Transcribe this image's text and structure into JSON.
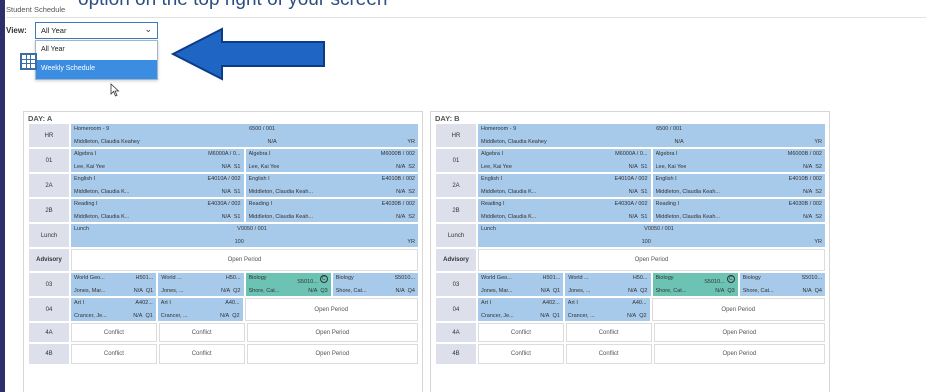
{
  "caption": "option on the top right of your screen",
  "app_title": "Student Schedule",
  "view": {
    "label": "View:",
    "selected": "All Year",
    "options": [
      "All Year",
      "Weekly Schedule"
    ],
    "highlighted_option": "Weekly Schedule"
  },
  "colors": {
    "accent": "#2c2f6b",
    "course_blue": "#a7c9ea",
    "course_green": "#6cc3b3",
    "arrow": "#1f66c4",
    "dropdown_highlight": "#3b8de2"
  },
  "icons": [
    "calendar-grid-icon",
    "cursor-pointer-icon",
    "left-arrow-icon",
    "chevron-down-icon"
  ],
  "days": [
    {
      "title": "DAY: A",
      "rows": [
        {
          "period": "HR",
          "cells": [
            {
              "l1": "Homeroom - 9",
              "l1r": "",
              "l1b": "6500 / 001",
              "l2": "Middleton, Claudia Keahey",
              "l2r": "",
              "l2b": "N/A",
              "tag": "YR"
            }
          ]
        },
        {
          "period": "01",
          "cells": [
            {
              "l1": "Algebra I",
              "l1r": "M6000A / 0...",
              "l2": "Lee, Kai Yee",
              "l2r": "N/A",
              "tag": "S1"
            },
            {
              "l1": "Algebra I",
              "l1r": "M6000B / 002",
              "l2": "Lee, Kai Yee",
              "l2r": "N/A",
              "tag": "S2"
            }
          ]
        },
        {
          "period": "2A",
          "cells": [
            {
              "l1": "English I",
              "l1r": "E4010A / 002",
              "l2": "Middleton, Claudia K...",
              "l2r": "N/A",
              "tag": "S1"
            },
            {
              "l1": "English I",
              "l1r": "E4010B / 002",
              "l2": "Middleton, Claudia Keah...",
              "l2r": "N/A",
              "tag": "S2"
            }
          ]
        },
        {
          "period": "2B",
          "cells": [
            {
              "l1": "Reading I",
              "l1r": "E4030A / 002",
              "l2": "Middleton, Claudia K...",
              "l2r": "N/A",
              "tag": "S1"
            },
            {
              "l1": "Reading I",
              "l1r": "E4030B / 002",
              "l2": "Middleton, Claudia Keah...",
              "l2r": "N/A",
              "tag": "S2"
            }
          ]
        },
        {
          "period": "Lunch",
          "cells": [
            {
              "l1": "Lunch",
              "l1b": "V0050 / 001",
              "l2": "",
              "l2b": "100",
              "tag": "YR"
            }
          ]
        },
        {
          "period": "Advisory",
          "cells": [
            {
              "text": "Open Period"
            }
          ]
        },
        {
          "period": "03",
          "cells": [
            {
              "l1": "World Geo...",
              "l1r": "H501...",
              "l2": "Jones, Mar...",
              "l2r": "N/A",
              "tag": "Q1"
            },
            {
              "l1": "World ...",
              "l1r": "H50...",
              "l2": "Jones, ...",
              "l2r": "N/A",
              "tag": "Q2"
            },
            {
              "l1": "Biology",
              "l1r": "S5010...",
              "l2": "Shore, Cat...",
              "l2r": "N/A",
              "tag": "Q3",
              "green": true,
              "badge": "C"
            },
            {
              "l1": "Biology",
              "l1r": "S5010...",
              "l2": "Shore, Cat...",
              "l2r": "N/A",
              "tag": "Q4"
            }
          ]
        },
        {
          "period": "04",
          "cells": [
            {
              "l1": "Art I",
              "l1r": "A402...",
              "l2": "Crancer, Je...",
              "l2r": "N/A",
              "tag": "Q1"
            },
            {
              "l1": "Art I",
              "l1r": "A40...",
              "l2": "Crancer, ...",
              "l2r": "N/A",
              "tag": "Q2"
            },
            {
              "text": "Open Period"
            }
          ]
        },
        {
          "period": "4A",
          "cells": [
            {
              "text": "Conflict"
            },
            {
              "text": "Conflict"
            },
            {
              "text": "Open Period"
            }
          ]
        },
        {
          "period": "4B",
          "cells": [
            {
              "text": "Conflict"
            },
            {
              "text": "Conflict"
            },
            {
              "text": "Open Period"
            }
          ]
        }
      ]
    },
    {
      "title": "DAY: B",
      "rows": [
        {
          "period": "HR",
          "cells": [
            {
              "l1": "Homeroom - 9",
              "l1r": "",
              "l1b": "6500 / 001",
              "l2": "Middleton, Claudia Keahey",
              "l2r": "",
              "l2b": "N/A",
              "tag": "YR"
            }
          ]
        },
        {
          "period": "01",
          "cells": [
            {
              "l1": "Algebra I",
              "l1r": "M6000A / 0...",
              "l2": "Lee, Kai Yee",
              "l2r": "N/A",
              "tag": "S1"
            },
            {
              "l1": "Algebra I",
              "l1r": "M6000B / 002",
              "l2": "Lee, Kai Yee",
              "l2r": "N/A",
              "tag": "S2"
            }
          ]
        },
        {
          "period": "2A",
          "cells": [
            {
              "l1": "English I",
              "l1r": "E4010A / 002",
              "l2": "Middleton, Claudia K...",
              "l2r": "N/A",
              "tag": "S1"
            },
            {
              "l1": "English I",
              "l1r": "E4010B / 002",
              "l2": "Middleton, Claudia Keah...",
              "l2r": "N/A",
              "tag": "S2"
            }
          ]
        },
        {
          "period": "2B",
          "cells": [
            {
              "l1": "Reading I",
              "l1r": "E4030A / 002",
              "l2": "Middleton, Claudia K...",
              "l2r": "N/A",
              "tag": "S1"
            },
            {
              "l1": "Reading I",
              "l1r": "E4030B / 002",
              "l2": "Middleton, Claudia Keah...",
              "l2r": "N/A",
              "tag": "S2"
            }
          ]
        },
        {
          "period": "Lunch",
          "cells": [
            {
              "l1": "Lunch",
              "l1b": "V0050 / 001",
              "l2": "",
              "l2b": "100",
              "tag": "YR"
            }
          ]
        },
        {
          "period": "Advisory",
          "cells": [
            {
              "text": "Open Period"
            }
          ]
        },
        {
          "period": "03",
          "cells": [
            {
              "l1": "World Geo...",
              "l1r": "H501...",
              "l2": "Jones, Mar...",
              "l2r": "N/A",
              "tag": "Q1"
            },
            {
              "l1": "World ...",
              "l1r": "H50...",
              "l2": "Jones, ...",
              "l2r": "N/A",
              "tag": "Q2"
            },
            {
              "l1": "Biology",
              "l1r": "S5010...",
              "l2": "Shore, Cat...",
              "l2r": "N/A",
              "tag": "Q3",
              "green": true,
              "badge": "C"
            },
            {
              "l1": "Biology",
              "l1r": "S5010...",
              "l2": "Shore, Cat...",
              "l2r": "N/A",
              "tag": "Q4"
            }
          ]
        },
        {
          "period": "04",
          "cells": [
            {
              "l1": "Art I",
              "l1r": "A402...",
              "l2": "Crancer, Je...",
              "l2r": "N/A",
              "tag": "Q1"
            },
            {
              "l1": "Art I",
              "l1r": "A40...",
              "l2": "Crancer, ...",
              "l2r": "N/A",
              "tag": "Q2"
            },
            {
              "text": "Open Period"
            }
          ]
        },
        {
          "period": "4A",
          "cells": [
            {
              "text": "Conflict"
            },
            {
              "text": "Conflict"
            },
            {
              "text": "Open Period"
            }
          ]
        },
        {
          "period": "4B",
          "cells": [
            {
              "text": "Conflict"
            },
            {
              "text": "Conflict"
            },
            {
              "text": "Open Period"
            }
          ]
        }
      ]
    }
  ]
}
